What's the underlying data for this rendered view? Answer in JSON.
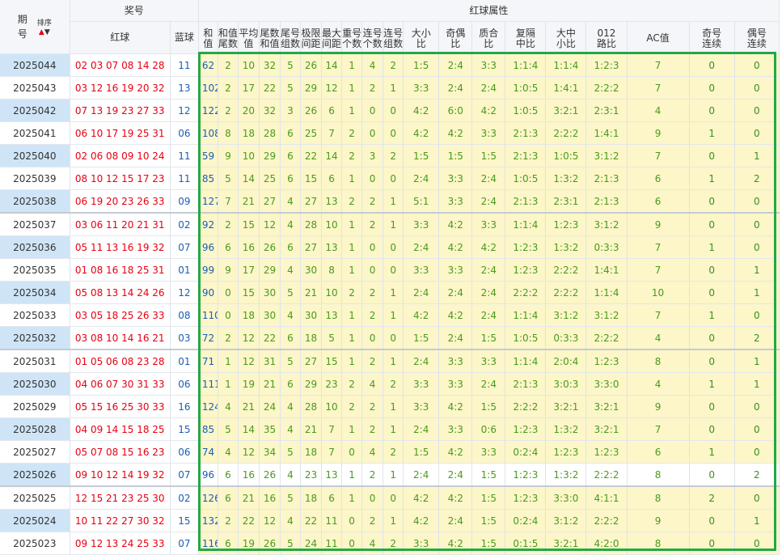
{
  "header": {
    "issue_label": "期\n号",
    "sort_label": "排序",
    "sort_arrows": {
      "up": "▲",
      "down": "▼"
    },
    "prize_group": "奖号",
    "red_label": "红球",
    "blue_label": "蓝球",
    "attr_group": "红球属性",
    "attr_columns": [
      "和值",
      "和值\n尾数",
      "平均\n值",
      "尾数\n和值",
      "尾号\n组数",
      "极限\n间距",
      "最大\n间距",
      "重号\n个数",
      "连号\n个数",
      "连号\n组数",
      "大小\n比",
      "奇偶\n比",
      "质合\n比",
      "复隔\n中比",
      "大中\n小比",
      "012\n路比",
      "AC值",
      "奇号\n连续",
      "偶号\n连续"
    ]
  },
  "rows": [
    {
      "issue": "2025044",
      "red": "02 03 07 08 14 28",
      "blue": "11",
      "attrs": [
        "62",
        "2",
        "10",
        "32",
        "5",
        "26",
        "14",
        "1",
        "4",
        "2",
        "1:5",
        "2:4",
        "3:3",
        "1:1:4",
        "1:1:4",
        "1:2:3",
        "7",
        "0",
        "0"
      ]
    },
    {
      "issue": "2025043",
      "red": "03 12 16 19 20 32",
      "blue": "13",
      "attrs": [
        "102",
        "2",
        "17",
        "22",
        "5",
        "29",
        "12",
        "1",
        "2",
        "1",
        "3:3",
        "2:4",
        "2:4",
        "1:0:5",
        "1:4:1",
        "2:2:2",
        "7",
        "0",
        "0"
      ]
    },
    {
      "issue": "2025042",
      "red": "07 13 19 23 27 33",
      "blue": "12",
      "attrs": [
        "122",
        "2",
        "20",
        "32",
        "3",
        "26",
        "6",
        "1",
        "0",
        "0",
        "4:2",
        "6:0",
        "4:2",
        "1:0:5",
        "3:2:1",
        "2:3:1",
        "4",
        "0",
        "0"
      ]
    },
    {
      "issue": "2025041",
      "red": "06 10 17 19 25 31",
      "blue": "06",
      "attrs": [
        "108",
        "8",
        "18",
        "28",
        "6",
        "25",
        "7",
        "2",
        "0",
        "0",
        "4:2",
        "4:2",
        "3:3",
        "2:1:3",
        "2:2:2",
        "1:4:1",
        "9",
        "1",
        "0"
      ]
    },
    {
      "issue": "2025040",
      "red": "02 06 08 09 10 24",
      "blue": "11",
      "attrs": [
        "59",
        "9",
        "10",
        "29",
        "6",
        "22",
        "14",
        "2",
        "3",
        "2",
        "1:5",
        "1:5",
        "1:5",
        "2:1:3",
        "1:0:5",
        "3:1:2",
        "7",
        "0",
        "1"
      ]
    },
    {
      "issue": "2025039",
      "red": "08 10 12 15 17 23",
      "blue": "11",
      "attrs": [
        "85",
        "5",
        "14",
        "25",
        "6",
        "15",
        "6",
        "1",
        "0",
        "0",
        "2:4",
        "3:3",
        "2:4",
        "1:0:5",
        "1:3:2",
        "2:1:3",
        "6",
        "1",
        "2"
      ]
    },
    {
      "issue": "2025038",
      "red": "06 19 20 23 26 33",
      "blue": "09",
      "attrs": [
        "127",
        "7",
        "21",
        "27",
        "4",
        "27",
        "13",
        "2",
        "2",
        "1",
        "5:1",
        "3:3",
        "2:4",
        "2:1:3",
        "2:3:1",
        "2:1:3",
        "6",
        "0",
        "0"
      ]
    },
    {
      "issue": "2025037",
      "red": "03 06 11 20 21 31",
      "blue": "02",
      "attrs": [
        "92",
        "2",
        "15",
        "12",
        "4",
        "28",
        "10",
        "1",
        "2",
        "1",
        "3:3",
        "4:2",
        "3:3",
        "1:1:4",
        "1:2:3",
        "3:1:2",
        "9",
        "0",
        "0"
      ]
    },
    {
      "issue": "2025036",
      "red": "05 11 13 16 19 32",
      "blue": "07",
      "attrs": [
        "96",
        "6",
        "16",
        "26",
        "6",
        "27",
        "13",
        "1",
        "0",
        "0",
        "2:4",
        "4:2",
        "4:2",
        "1:2:3",
        "1:3:2",
        "0:3:3",
        "7",
        "1",
        "0"
      ]
    },
    {
      "issue": "2025035",
      "red": "01 08 16 18 25 31",
      "blue": "01",
      "attrs": [
        "99",
        "9",
        "17",
        "29",
        "4",
        "30",
        "8",
        "1",
        "0",
        "0",
        "3:3",
        "3:3",
        "2:4",
        "1:2:3",
        "2:2:2",
        "1:4:1",
        "7",
        "0",
        "1"
      ]
    },
    {
      "issue": "2025034",
      "red": "05 08 13 14 24 26",
      "blue": "12",
      "attrs": [
        "90",
        "0",
        "15",
        "30",
        "5",
        "21",
        "10",
        "2",
        "2",
        "1",
        "2:4",
        "2:4",
        "2:4",
        "2:2:2",
        "2:2:2",
        "1:1:4",
        "10",
        "0",
        "1"
      ]
    },
    {
      "issue": "2025033",
      "red": "03 05 18 25 26 33",
      "blue": "08",
      "attrs": [
        "110",
        "0",
        "18",
        "30",
        "4",
        "30",
        "13",
        "1",
        "2",
        "1",
        "4:2",
        "4:2",
        "2:4",
        "1:1:4",
        "3:1:2",
        "3:1:2",
        "7",
        "1",
        "0"
      ]
    },
    {
      "issue": "2025032",
      "red": "03 08 10 14 16 21",
      "blue": "03",
      "attrs": [
        "72",
        "2",
        "12",
        "22",
        "6",
        "18",
        "5",
        "1",
        "0",
        "0",
        "1:5",
        "2:4",
        "1:5",
        "1:0:5",
        "0:3:3",
        "2:2:2",
        "4",
        "0",
        "2"
      ]
    },
    {
      "issue": "2025031",
      "red": "01 05 06 08 23 28",
      "blue": "01",
      "attrs": [
        "71",
        "1",
        "12",
        "31",
        "5",
        "27",
        "15",
        "1",
        "2",
        "1",
        "2:4",
        "3:3",
        "3:3",
        "1:1:4",
        "2:0:4",
        "1:2:3",
        "8",
        "0",
        "1"
      ]
    },
    {
      "issue": "2025030",
      "red": "04 06 07 30 31 33",
      "blue": "06",
      "attrs": [
        "111",
        "1",
        "19",
        "21",
        "6",
        "29",
        "23",
        "2",
        "4",
        "2",
        "3:3",
        "3:3",
        "2:4",
        "2:1:3",
        "3:0:3",
        "3:3:0",
        "4",
        "1",
        "1"
      ]
    },
    {
      "issue": "2025029",
      "red": "05 15 16 25 30 33",
      "blue": "16",
      "attrs": [
        "124",
        "4",
        "21",
        "24",
        "4",
        "28",
        "10",
        "2",
        "2",
        "1",
        "3:3",
        "4:2",
        "1:5",
        "2:2:2",
        "3:2:1",
        "3:2:1",
        "9",
        "0",
        "0"
      ]
    },
    {
      "issue": "2025028",
      "red": "04 09 14 15 18 25",
      "blue": "15",
      "attrs": [
        "85",
        "5",
        "14",
        "35",
        "4",
        "21",
        "7",
        "1",
        "2",
        "1",
        "2:4",
        "3:3",
        "0:6",
        "1:2:3",
        "1:3:2",
        "3:2:1",
        "7",
        "0",
        "0"
      ]
    },
    {
      "issue": "2025027",
      "red": "05 07 08 15 16 23",
      "blue": "06",
      "attrs": [
        "74",
        "4",
        "12",
        "34",
        "5",
        "18",
        "7",
        "0",
        "4",
        "2",
        "1:5",
        "4:2",
        "3:3",
        "0:2:4",
        "1:2:3",
        "1:2:3",
        "6",
        "1",
        "0"
      ]
    },
    {
      "issue": "2025026",
      "red": "09 10 12 14 19 32",
      "blue": "07",
      "attrs": [
        "96",
        "6",
        "16",
        "26",
        "4",
        "23",
        "13",
        "1",
        "2",
        "1",
        "2:4",
        "2:4",
        "1:5",
        "1:2:3",
        "1:3:2",
        "2:2:2",
        "8",
        "0",
        "2"
      ]
    },
    {
      "issue": "2025025",
      "red": "12 15 21 23 25 30",
      "blue": "02",
      "attrs": [
        "126",
        "6",
        "21",
        "16",
        "5",
        "18",
        "6",
        "1",
        "0",
        "0",
        "4:2",
        "4:2",
        "1:5",
        "1:2:3",
        "3:3:0",
        "4:1:1",
        "8",
        "2",
        "0"
      ]
    },
    {
      "issue": "2025024",
      "red": "10 11 22 27 30 32",
      "blue": "15",
      "attrs": [
        "132",
        "2",
        "22",
        "12",
        "4",
        "22",
        "11",
        "0",
        "2",
        "1",
        "4:2",
        "2:4",
        "1:5",
        "0:2:4",
        "3:1:2",
        "2:2:2",
        "9",
        "0",
        "1"
      ]
    },
    {
      "issue": "2025023",
      "red": "09 12 13 24 25 33",
      "blue": "07",
      "attrs": [
        "116",
        "6",
        "19",
        "26",
        "5",
        "24",
        "11",
        "0",
        "4",
        "2",
        "3:3",
        "4:2",
        "1:5",
        "0:1:5",
        "3:2:1",
        "4:2:0",
        "8",
        "0",
        "0"
      ]
    }
  ],
  "colors": {
    "red_ball": "#e60012",
    "blue_ball": "#1a5fb4",
    "attr_bg": "#fcf6c8",
    "attr_text": "#4a9a1f",
    "highlight_border": "#22a847",
    "issue_highlight": "#cfe5f7"
  }
}
